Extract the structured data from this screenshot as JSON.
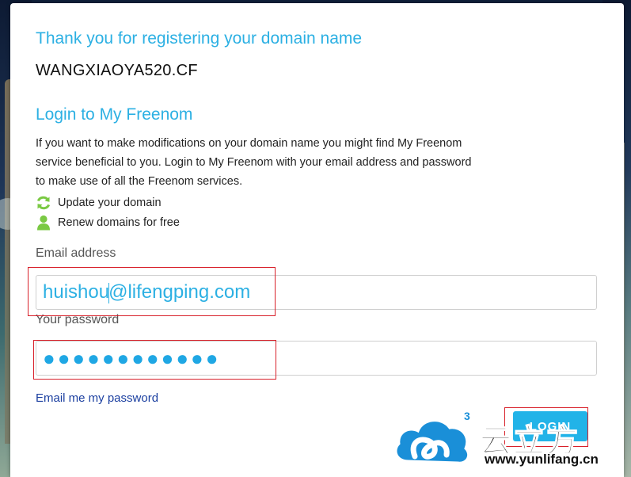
{
  "confirmation": {
    "heading": "Thank you for registering your domain name",
    "domain": "WANGXIAOYA520.CF"
  },
  "login": {
    "heading": "Login to My Freenom",
    "description": "If you want to make modifications on your domain name you might find My Freenom service beneficial to you. Login to My Freenom with your email address and password to make use of all the Freenom services.",
    "features": [
      {
        "icon": "refresh-icon",
        "label": "Update your domain"
      },
      {
        "icon": "user-icon",
        "label": "Renew domains for free"
      }
    ],
    "email_label": "Email address",
    "email_value_part1": "huishou",
    "email_value_part2": "@lifengping.com",
    "password_label": "Your password",
    "password_value": "●●●●●●●●●●●●",
    "forgot_link": "Email me my password",
    "submit_label": "LOGIN"
  },
  "watermark": {
    "brand_cn": "云立方",
    "url": "www.yunlifang.cn",
    "superscript": "3"
  },
  "colors": {
    "accent": "#2cb0e3",
    "button": "#22b3e8",
    "icon_green": "#7ac943",
    "link": "#1b3fa0",
    "annotation_red": "#d8202a"
  }
}
